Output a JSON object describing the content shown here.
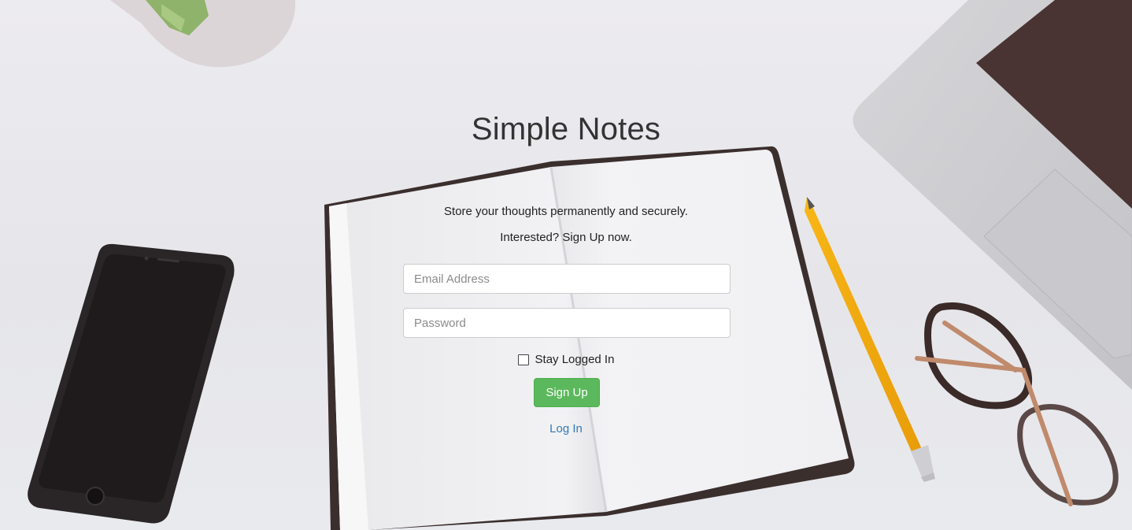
{
  "app": {
    "title": "Simple Notes",
    "tagline": "Store your thoughts permanently and securely.",
    "cta_text": "Interested? Sign Up now."
  },
  "form": {
    "email": {
      "placeholder": "Email Address",
      "value": ""
    },
    "password": {
      "placeholder": "Password",
      "value": ""
    },
    "remember_label": "Stay Logged In",
    "remember_checked": false,
    "submit_label": "Sign Up",
    "toggle_link": "Log In"
  },
  "colors": {
    "primary_button": "#5cb85c",
    "link": "#337ab7",
    "text": "#333333"
  }
}
